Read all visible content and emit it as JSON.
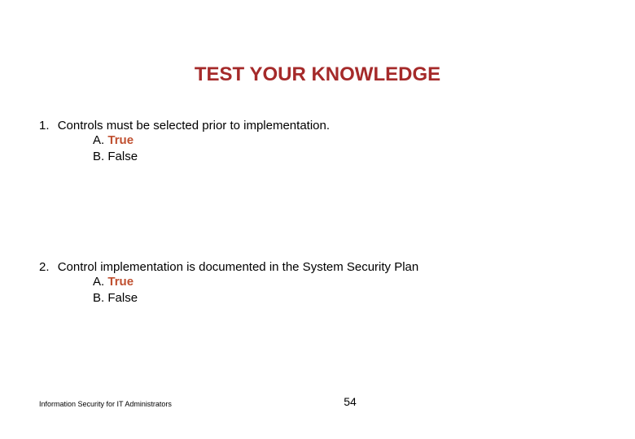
{
  "title": "TEST YOUR KNOWLEDGE",
  "questions": [
    {
      "number": "1.",
      "text": "Controls must be selected prior to implementation.",
      "answers": [
        {
          "label": "A.",
          "text": "True",
          "correct": true
        },
        {
          "label": "B.",
          "text": "False",
          "correct": false
        }
      ]
    },
    {
      "number": "2.",
      "text": "Control implementation is documented in the System Security Plan",
      "answers": [
        {
          "label": "A.",
          "text": "True",
          "correct": true
        },
        {
          "label": "B.",
          "text": "False",
          "correct": false
        }
      ]
    }
  ],
  "footer": "Information Security for IT Administrators",
  "page_number": "54"
}
